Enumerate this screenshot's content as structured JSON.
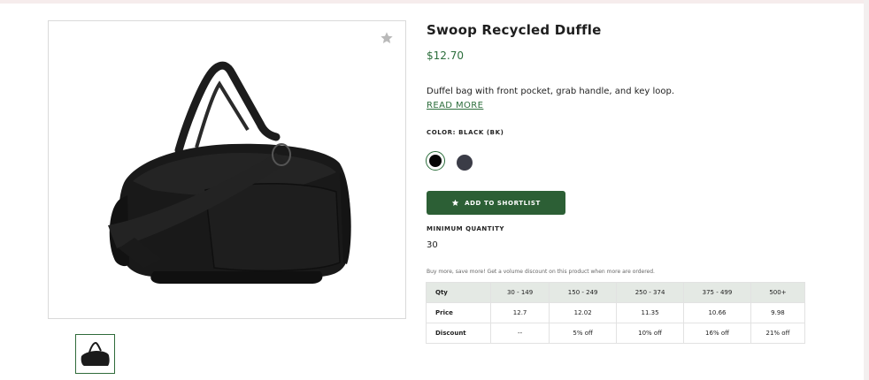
{
  "product": {
    "title": "Swoop Recycled Duffle",
    "price": "$12.70",
    "description": "Duffel bag with front pocket, grab handle, and key loop.",
    "read_more": "READ MORE",
    "color_label": "COLOR: BLACK (BK)",
    "swatches": [
      {
        "name": "Black",
        "hex": "#050505",
        "selected": true
      },
      {
        "name": "Dark Gray",
        "hex": "#3b3c47",
        "selected": false
      }
    ],
    "add_button": "ADD TO SHORTLIST",
    "min_qty_label": "MINIMUM QUANTITY",
    "min_qty_value": "30"
  },
  "volume": {
    "note": "Buy more, save more! Get a volume discount on this product when more are ordered.",
    "rows": [
      [
        "Qty",
        "30 - 149",
        "150 - 249",
        "250 - 374",
        "375 - 499",
        "500+"
      ],
      [
        "Price",
        "12.7",
        "12.02",
        "11.35",
        "10.66",
        "9.98"
      ],
      [
        "Discount",
        "--",
        "5% off",
        "10% off",
        "16% off",
        "21% off"
      ]
    ]
  },
  "colors": {
    "accent": "#2c5f35",
    "accent_text": "#2c6e3c",
    "table_header": "#e4e9e4"
  },
  "icons": {
    "favorite": "star-icon",
    "button": "star-icon"
  }
}
